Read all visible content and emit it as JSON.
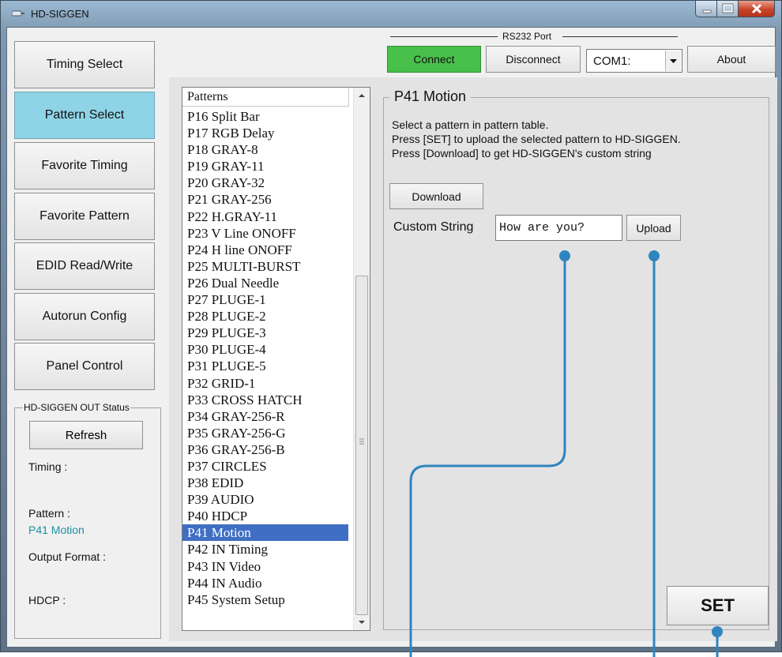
{
  "window": {
    "title": "HD-SIGGEN",
    "title_icon": "device-icon"
  },
  "nav": {
    "items": [
      {
        "label": "Timing Select",
        "active": false
      },
      {
        "label": "Pattern Select",
        "active": true
      },
      {
        "label": "Favorite Timing",
        "active": false
      },
      {
        "label": "Favorite Pattern",
        "active": false
      },
      {
        "label": "EDID Read/Write",
        "active": false
      },
      {
        "label": "Autorun Config",
        "active": false
      },
      {
        "label": "Panel Control",
        "active": false
      }
    ]
  },
  "status": {
    "legend": "HD-SIGGEN OUT Status",
    "refresh_label": "Refresh",
    "timing_label": "Timing :",
    "pattern_label": "Pattern :",
    "pattern_value": "P41 Motion",
    "output_format_label": "Output Format :",
    "hdcp_label": "HDCP :"
  },
  "rs232": {
    "label": "RS232 Port",
    "connect_label": "Connect",
    "disconnect_label": "Disconnect",
    "port_value": "COM1:",
    "about_label": "About",
    "connect_color": "#48c04a"
  },
  "patterns": {
    "header": "Patterns",
    "items": [
      "P16 Split Bar",
      "P17 RGB Delay",
      "P18 GRAY-8",
      "P19 GRAY-11",
      "P20 GRAY-32",
      "P21 GRAY-256",
      "P22 H.GRAY-11",
      "P23 V Line ONOFF",
      "P24 H line ONOFF",
      "P25 MULTI-BURST",
      "P26 Dual Needle",
      "P27 PLUGE-1",
      "P28 PLUGE-2",
      "P29 PLUGE-3",
      "P30 PLUGE-4",
      "P31 PLUGE-5",
      "P32 GRID-1",
      "P33 CROSS HATCH",
      "P34 GRAY-256-R",
      "P35 GRAY-256-G",
      "P36 GRAY-256-B",
      "P37 CIRCLES",
      "P38 EDID",
      "P39 AUDIO",
      "P40 HDCP",
      "P41 Motion",
      "P42 IN Timing",
      "P43 IN Video",
      "P44 IN Audio",
      "P45 System Setup"
    ],
    "selected": "P41 Motion"
  },
  "detail": {
    "title": "P41 Motion",
    "line1": "Select a pattern in pattern table.",
    "line2": "Press [SET] to upload the selected pattern to HD-SIGGEN.",
    "line3": "Press [Download] to get HD-SIGGEN's custom string",
    "download_label": "Download",
    "custom_string_label": "Custom String",
    "custom_string_value": "How are you?",
    "upload_label": "Upload",
    "set_label": "SET"
  },
  "colors": {
    "selection": "#3f6ec3",
    "active_nav": "#8fd3e6",
    "callout": "#2f85bf",
    "status_value": "#1a8ea3"
  }
}
